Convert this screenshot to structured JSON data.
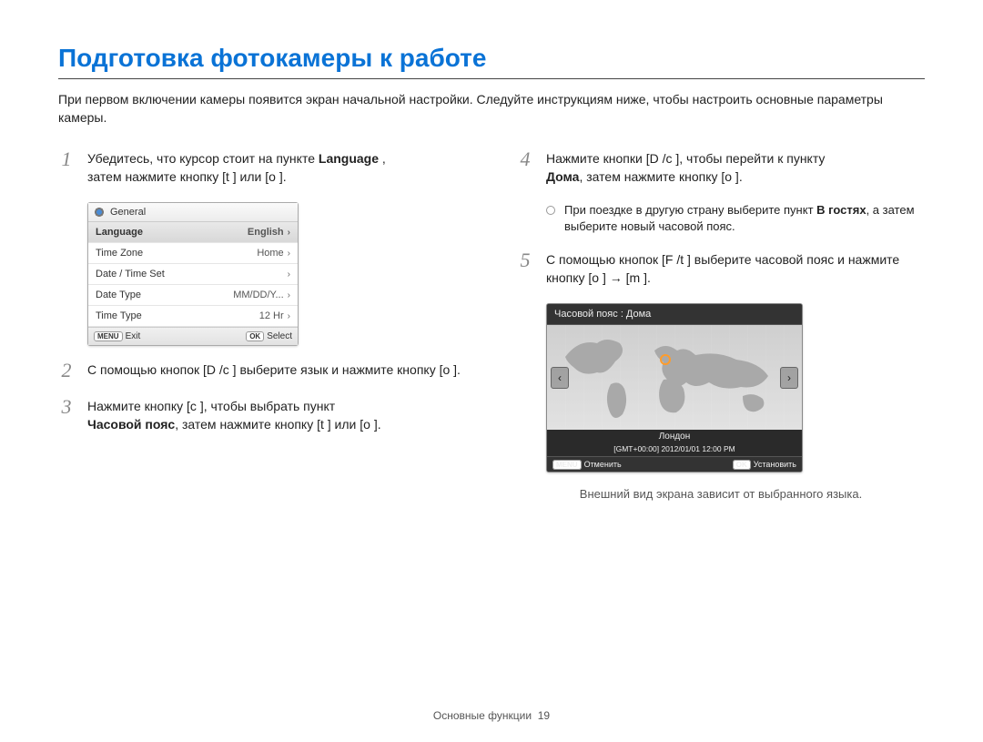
{
  "title": "Подготовка фотокамеры к работе",
  "intro": "При первом включении камеры появится экран начальной настройки. Следуйте инструкциям ниже, чтобы настроить основные параметры камеры.",
  "left": {
    "step1": {
      "num": "1",
      "line1_a": "Убедитесь, что курсор стоит на пункте ",
      "line1_b": "Language",
      "line1_c": " ,",
      "line2": "затем нажмите кнопку [t    ] или [o    ]."
    },
    "lcd": {
      "head": "General",
      "rows": [
        {
          "label": "Language",
          "value": "English",
          "selected": true
        },
        {
          "label": "Time Zone",
          "value": "Home",
          "selected": false
        },
        {
          "label": "Date / Time Set",
          "value": "",
          "selected": false
        },
        {
          "label": "Date Type",
          "value": "MM/DD/Y...",
          "selected": false
        },
        {
          "label": "Time Type",
          "value": "12 Hr",
          "selected": false
        }
      ],
      "foot_left_btn": "MENU",
      "foot_left_text": "Exit",
      "foot_right_btn": "OK",
      "foot_right_text": "Select"
    },
    "step2": {
      "num": "2",
      "text": "С помощью кнопок [D      /c    ] выберите язык и нажмите кнопку [o    ]."
    },
    "step3": {
      "num": "3",
      "line1": "Нажмите кнопку [c    ], чтобы выбрать пункт ",
      "kw": "Часовой пояс",
      "line2": ", затем нажмите кнопку [t    ] или [o    ]."
    }
  },
  "right": {
    "step4": {
      "num": "4",
      "line1": "Нажмите кнопки [D      /c    ], чтобы перейти к пункту ",
      "kw": "Дома",
      "line2": ", затем нажмите кнопку [o    ]."
    },
    "note": {
      "a": "При поездке в другую страну выберите пункт ",
      "kw": "В гостях",
      "b": ", а затем выберите новый часовой пояс."
    },
    "step5": {
      "num": "5",
      "text": "С помощью кнопок [F /t    ] выберите часовой пояс и нажмите кнопку [o    ] → [m      ]."
    },
    "tz": {
      "title": "Часовой пояс : Дома",
      "city": "Лондон",
      "stamp": "[GMT+00:00] 2012/01/01 12:00 PM",
      "foot_left_btn": "MENU",
      "foot_left_text": "Отменить",
      "foot_right_btn": "OK",
      "foot_right_text": "Установить"
    },
    "caption": "Внешний вид экрана зависит от выбранного языка."
  },
  "footer": {
    "section": "Основные функции",
    "page": "19"
  }
}
